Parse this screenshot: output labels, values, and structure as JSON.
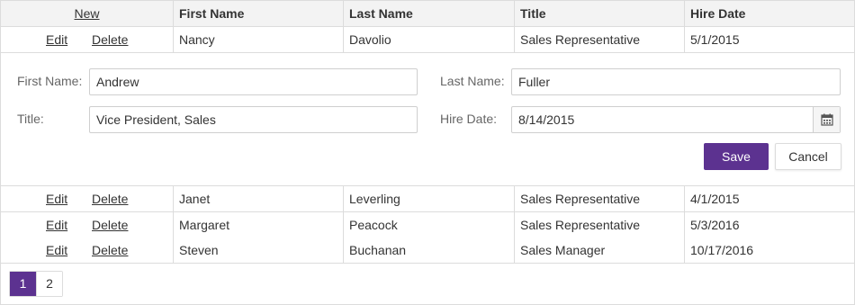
{
  "toolbar": {
    "new_label": "New"
  },
  "columns": [
    "First Name",
    "Last Name",
    "Title",
    "Hire Date"
  ],
  "commands": {
    "edit": "Edit",
    "delete": "Delete"
  },
  "rows": [
    {
      "first": "Nancy",
      "last": "Davolio",
      "title": "Sales Representative",
      "hire": "5/1/2015"
    },
    {
      "first": "Janet",
      "last": "Leverling",
      "title": "Sales Representative",
      "hire": "4/1/2015"
    },
    {
      "first": "Margaret",
      "last": "Peacock",
      "title": "Sales Representative",
      "hire": "5/3/2016"
    },
    {
      "first": "Steven",
      "last": "Buchanan",
      "title": "Sales Manager",
      "hire": "10/17/2016"
    }
  ],
  "edit_form": {
    "first_name_label": "First Name:",
    "first_name_value": "Andrew",
    "last_name_label": "Last Name:",
    "last_name_value": "Fuller",
    "title_label": "Title:",
    "title_value": "Vice President, Sales",
    "hire_date_label": "Hire Date:",
    "hire_date_value": "8/14/2015",
    "save_label": "Save",
    "cancel_label": "Cancel"
  },
  "pager": {
    "pages": [
      "1",
      "2"
    ],
    "current": "1"
  },
  "colors": {
    "accent": "#5c3290",
    "header_bg": "#f3f3f3",
    "border": "#dcdcdc"
  },
  "icons": {
    "calendar": "calendar-icon"
  }
}
